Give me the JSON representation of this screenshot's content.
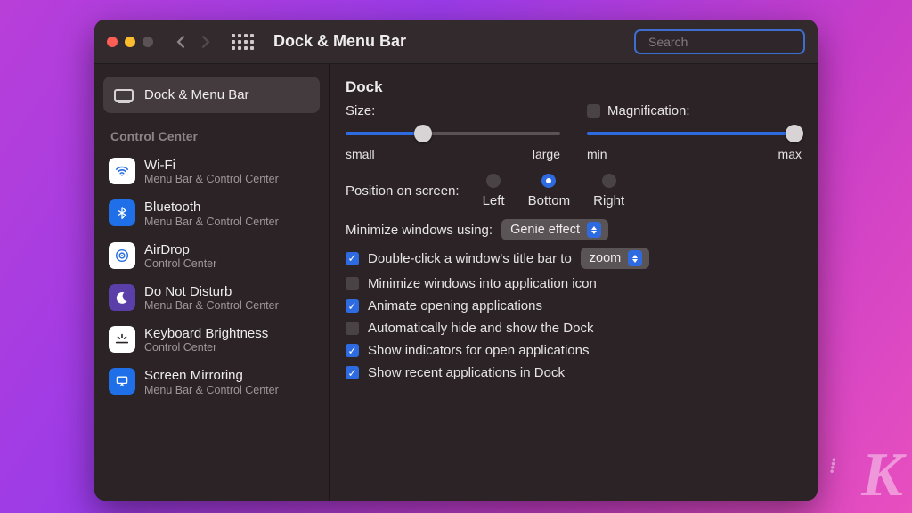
{
  "titlebar": {
    "title": "Dock & Menu Bar",
    "search_placeholder": "Search"
  },
  "sidebar": {
    "selected_label": "Dock & Menu Bar",
    "section": "Control Center",
    "items": [
      {
        "title": "Wi-Fi",
        "sub": "Menu Bar & Control Center"
      },
      {
        "title": "Bluetooth",
        "sub": "Menu Bar & Control Center"
      },
      {
        "title": "AirDrop",
        "sub": "Control Center"
      },
      {
        "title": "Do Not Disturb",
        "sub": "Menu Bar & Control Center"
      },
      {
        "title": "Keyboard Brightness",
        "sub": "Control Center"
      },
      {
        "title": "Screen Mirroring",
        "sub": "Menu Bar & Control Center"
      }
    ]
  },
  "main": {
    "heading": "Dock",
    "size_label": "Size:",
    "size_left": "small",
    "size_right": "large",
    "mag_label": "Magnification:",
    "mag_left": "min",
    "mag_right": "max",
    "position_label": "Position on screen:",
    "pos_left": "Left",
    "pos_bottom": "Bottom",
    "pos_right": "Right",
    "minimize_label": "Minimize windows using:",
    "minimize_value": "Genie effect",
    "dbl_label": "Double-click a window's title bar to",
    "dbl_value": "zoom",
    "opt_min_into": "Minimize windows into application icon",
    "opt_animate": "Animate opening applications",
    "opt_autohide": "Automatically hide and show the Dock",
    "opt_indicators": "Show indicators for open applications",
    "opt_recent": "Show recent applications in Dock"
  }
}
